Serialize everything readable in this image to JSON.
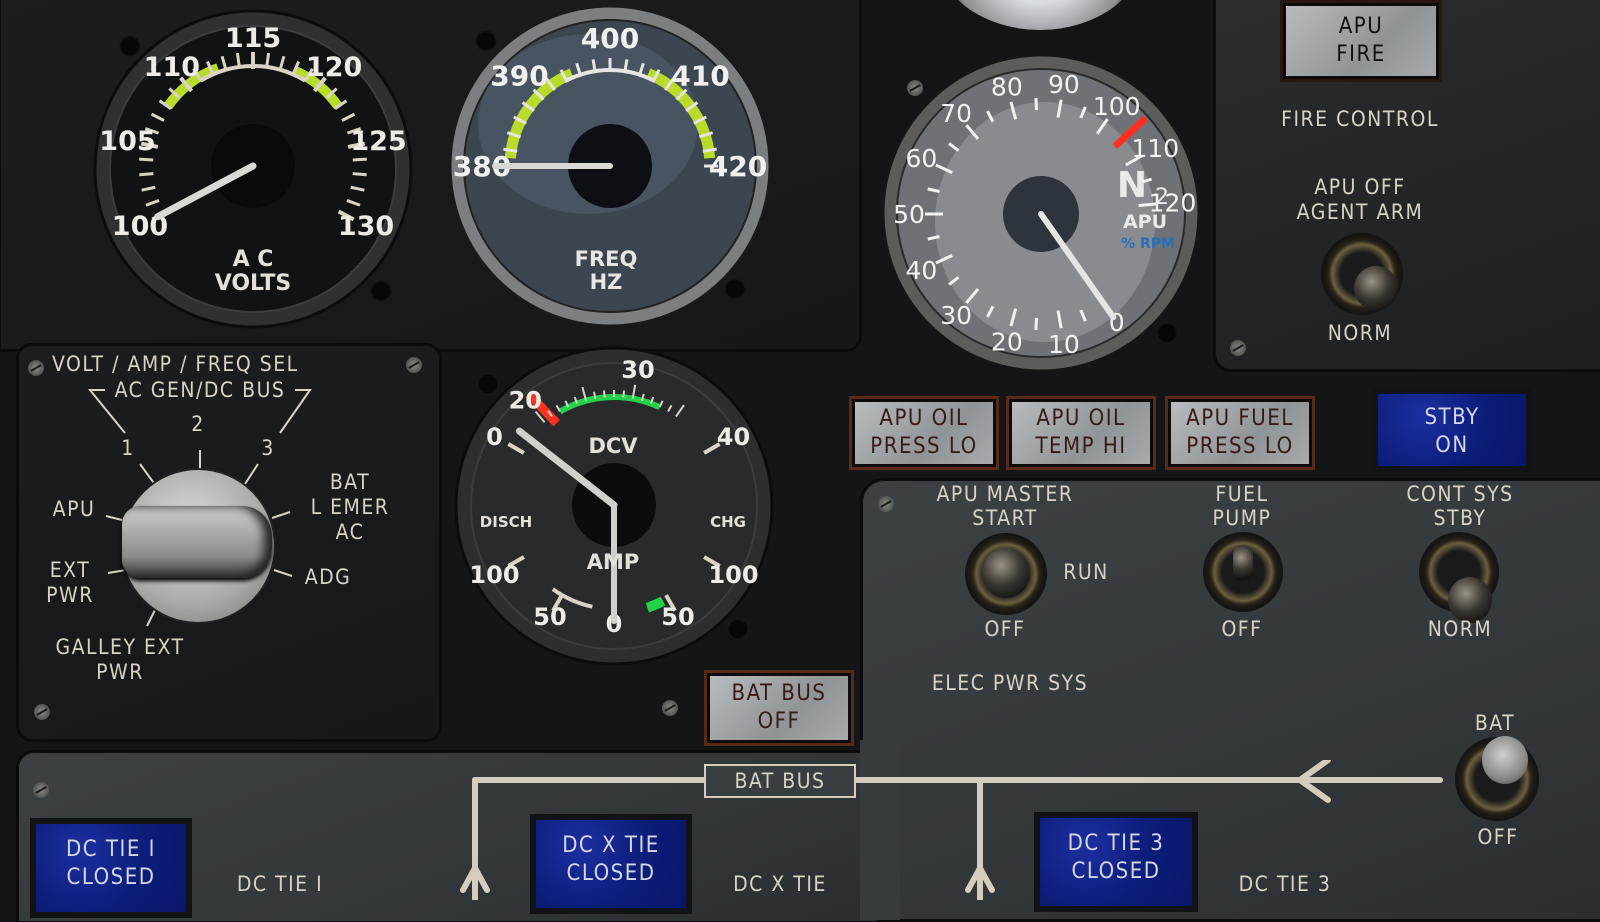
{
  "scene": "Aircraft overhead electrical power / APU control panel",
  "gauges": {
    "ac_volts": {
      "label_line1": "A C",
      "label_line2": "VOLTS",
      "ticks": [
        "100",
        "105",
        "110",
        "115",
        "120",
        "125",
        "130"
      ],
      "min": 100,
      "max": 130,
      "green_band": [
        108,
        122
      ],
      "needle_value": 100
    },
    "freq_hz": {
      "label_line1": "FREQ",
      "label_line2": "HZ",
      "ticks": [
        "380",
        "390",
        "400",
        "410",
        "420"
      ],
      "min": 380,
      "max": 420,
      "green_band": [
        380,
        420
      ],
      "needle_value": 380
    },
    "apu_rpm": {
      "label_n": "N",
      "label_sub": "2",
      "label_apu": "APU",
      "label_rpm": "% RPM",
      "ticks": [
        "0",
        "10",
        "20",
        "30",
        "40",
        "50",
        "60",
        "70",
        "80",
        "90",
        "100",
        "110",
        "120"
      ],
      "min": 0,
      "max": 120,
      "red_line": 105,
      "needle_value": 0
    },
    "dc_volt_amp": {
      "label_volt": "DCV",
      "label_amp": "AMP",
      "label_disch": "DISCH",
      "label_chg": "CHG",
      "volt_ticks": [
        "0",
        "20",
        "30",
        "40"
      ],
      "amp_ticks_left": [
        "100",
        "50"
      ],
      "amp_center": "0",
      "amp_ticks_right": [
        "50",
        "100"
      ],
      "volt_needle_value": 0,
      "amp_needle_value": 0
    }
  },
  "selector": {
    "title": "VOLT / AMP / FREQ SEL",
    "subtitle": "AC GEN/DC BUS",
    "positions": [
      "1",
      "2",
      "3",
      "BAT\nL EMER\nAC",
      "ADG",
      "GALLEY EXT\nPWR",
      "EXT\nPWR",
      "APU"
    ]
  },
  "fire_control": {
    "annunciator": [
      "APU",
      "FIRE"
    ],
    "title": "FIRE CONTROL",
    "switch_label_top": [
      "APU OFF",
      "AGENT ARM"
    ],
    "switch_label_bottom": "NORM"
  },
  "caution_lights": [
    {
      "line1": "APU OIL",
      "line2": "PRESS LO"
    },
    {
      "line1": "APU OIL",
      "line2": "TEMP HI"
    },
    {
      "line1": "APU FUEL",
      "line2": "PRESS LO"
    }
  ],
  "stby_light": {
    "line1": "STBY",
    "line2": "ON"
  },
  "bat_bus_off_light": {
    "line1": "BAT BUS",
    "line2": "OFF"
  },
  "elec_panel": {
    "apu_master": {
      "top": [
        "APU MASTER",
        "START"
      ],
      "right": "RUN",
      "bottom": "OFF"
    },
    "fuel_pump": {
      "top": [
        "FUEL",
        "PUMP"
      ],
      "bottom": "OFF"
    },
    "cont_sys": {
      "top": [
        "CONT SYS",
        "STBY"
      ],
      "bottom": "NORM"
    },
    "section_title": "ELEC PWR SYS"
  },
  "bus_diagram": {
    "bat_bus_label": "BAT BUS",
    "bat_switch": {
      "top": "BAT",
      "bottom": "OFF"
    },
    "tie_lights": [
      {
        "line1": "DC TIE I",
        "line2": "CLOSED",
        "caption": "DC TIE I"
      },
      {
        "line1": "DC X TIE",
        "line2": "CLOSED",
        "caption": "DC X TIE"
      },
      {
        "line1": "DC TIE 3",
        "line2": "CLOSED",
        "caption": "DC TIE 3"
      }
    ]
  },
  "colors": {
    "green_band": "#b9dc2a",
    "red_line": "#ff3020",
    "amp_green": "#23d24a",
    "marking": "#d8d3c4",
    "annunciator_text": "#3a1a14",
    "blue_lens": "#0c1c78"
  }
}
